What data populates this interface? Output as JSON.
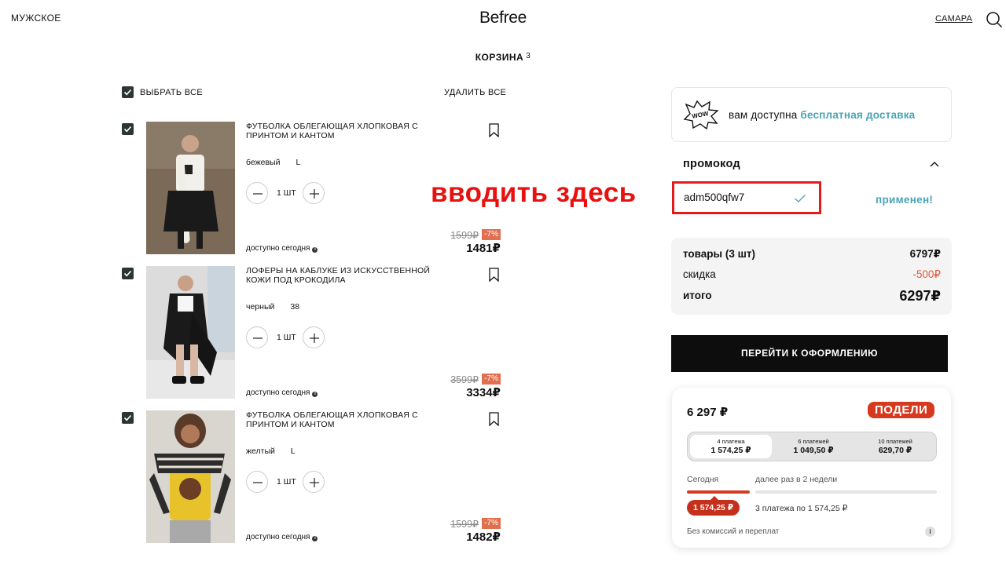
{
  "header": {
    "gender_link": "МУЖСКОЕ",
    "logo": "Befree",
    "city": "САМАРА"
  },
  "cart": {
    "title": "КОРЗИНА",
    "count": "3",
    "select_all_label": "ВЫБРАТЬ ВСЕ",
    "delete_all_label": "УДАЛИТЬ ВСЕ"
  },
  "items": [
    {
      "name": "ФУТБОЛКА ОБЛЕГАЮЩАЯ ХЛОПКОВАЯ С ПРИНТОМ И КАНТОМ",
      "color": "бежевый",
      "size": "L",
      "quantity": "1 ШТ",
      "availability": "доступно сегодня",
      "old_price": "1599₽",
      "discount": "-7%",
      "price": "1481₽",
      "photo_colors": {
        "bg": "#7b6a58",
        "top": "#f2f0ea",
        "bottom": "#1a1a1a"
      }
    },
    {
      "name": "ЛОФЕРЫ НА КАБЛУКЕ ИЗ ИСКУССТВЕННОЙ КОЖИ ПОД КРОКОДИЛА",
      "color": "черный",
      "size": "38",
      "quantity": "1 ШТ",
      "availability": "доступно сегодня",
      "old_price": "3599₽",
      "discount": "-7%",
      "price": "3334₽",
      "photo_colors": {
        "bg": "#dcdcdc",
        "top": "#1a1a1a",
        "bottom": "#f6f6f6"
      }
    },
    {
      "name": "ФУТБОЛКА ОБЛЕГАЮЩАЯ ХЛОПКОВАЯ С ПРИНТОМ И КАНТОМ",
      "color": "желтый",
      "size": "L",
      "quantity": "1 ШТ",
      "availability": "доступно сегодня",
      "old_price": "1599₽",
      "discount": "-7%",
      "price": "1482₽",
      "photo_colors": {
        "bg": "#d8d6cf",
        "top": "#e8c22a",
        "bottom": "#2c2c2c"
      }
    }
  ],
  "overlay_text": "вводить здесь",
  "delivery": {
    "prefix": "вам доступна",
    "link": "бесплатная доставка",
    "badge": "WOW"
  },
  "promo": {
    "title": "промокод",
    "value": "adm500qfw7",
    "status": "применен!"
  },
  "summary": {
    "goods_label": "товары (3 шт)",
    "goods_value": "6797₽",
    "discount_label": "скидка",
    "discount_value": "-500₽",
    "total_label": "итого",
    "total_value": "6297₽"
  },
  "checkout_label": "ПЕРЕЙТИ К ОФОРМЛЕНИЮ",
  "podeli": {
    "total": "6 297 ₽",
    "logo": "ПОДЕЛИ",
    "plans": [
      {
        "label": "4 платежа",
        "amount": "1 574,25 ₽"
      },
      {
        "label": "6 платежей",
        "amount": "1 049,50 ₽"
      },
      {
        "label": "10 платежей",
        "amount": "629,70 ₽"
      }
    ],
    "today_label": "Сегодня",
    "later_label": "далее раз в 2 недели",
    "first_payment": "1 574,25 ₽",
    "rest_payments": "3 платежа по 1 574,25 ₽",
    "no_fee": "Без комиссий и переплат"
  },
  "colors": {
    "accent_teal": "#4aa3b4",
    "discount_orange": "#e2704f",
    "podeli_red": "#d6391e",
    "overlay_red": "#e8110f"
  }
}
